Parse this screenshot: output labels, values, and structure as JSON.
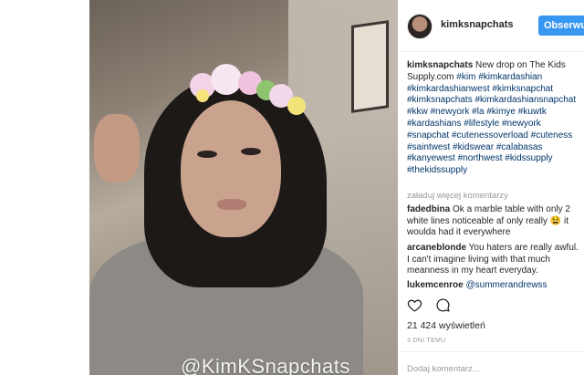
{
  "watermark": "@KimKSnapchats",
  "header": {
    "username": "kimksnapchats",
    "follow_label": "Obserwuj"
  },
  "caption": {
    "username": "kimksnapchats",
    "text_start": " New drop on The Kids Supply.com ",
    "hashtags": [
      "#kim",
      "#kimkardashian",
      "#kimkardashianwest",
      "#kimksnapchat",
      "#kimksnapchats",
      "#kimkardashiansnapchat",
      "#kkw",
      "#newyork",
      "#la",
      "#kimye",
      "#kuwtk",
      "#kardashians",
      "#lifestyle",
      "#newyork",
      "#snapchat",
      "#cutenessoverload",
      "#cuteness",
      "#saintwest",
      "#kidswear",
      "#calabasas",
      "#kanyewest",
      "#northwest",
      "#kidssupply",
      "#thekidssupply"
    ]
  },
  "load_more": "załaduj więcej komentarzy",
  "comments": [
    {
      "user": "fadedbina",
      "text": " Ok a marble table with only 2 white lines noticeable af only really 😫 it woulda had it everywhere"
    },
    {
      "user": "arcaneblonde",
      "text": " You haters are really awful. I can't imagine living with that much meanness in my heart everyday."
    },
    {
      "user": "lukemcenroe",
      "text": " ",
      "mention": "@summerandrewss"
    }
  ],
  "icons": {
    "like": "heart-outline-icon",
    "comment": "speech-bubble-icon"
  },
  "views": "21 424 wyświetleń",
  "date": "3 DNI TEMU",
  "add_comment_placeholder": "Dodaj komentarz..."
}
